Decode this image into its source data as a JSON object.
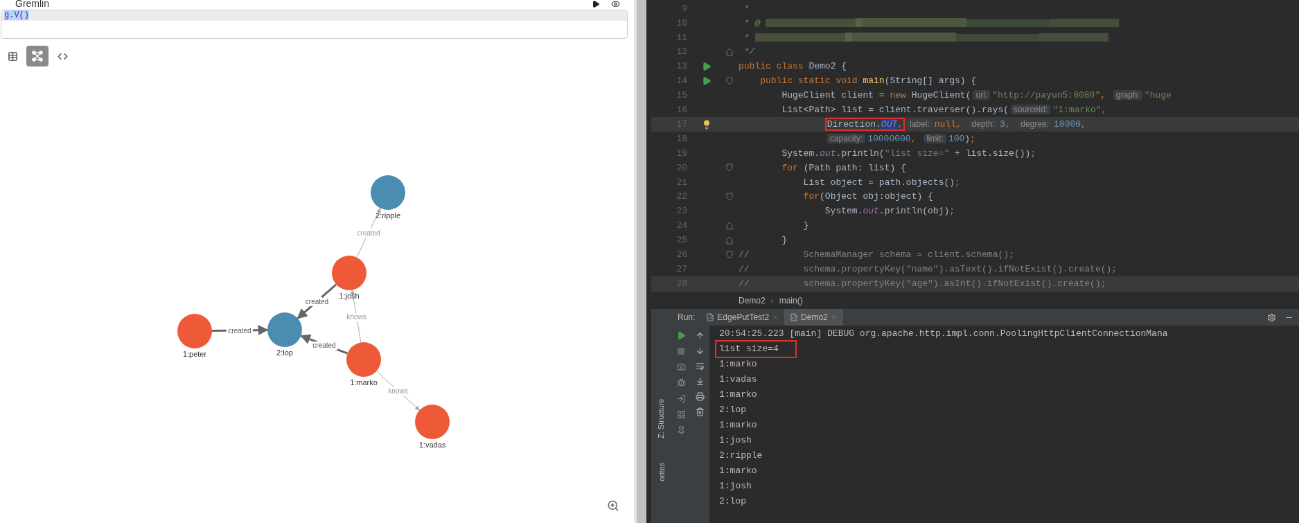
{
  "gremlin": {
    "title": "Gremlin",
    "query": "g.V()",
    "views": [
      {
        "kind": "table",
        "selected": false
      },
      {
        "kind": "graph",
        "selected": true
      },
      {
        "kind": "code",
        "selected": false
      }
    ],
    "graph": {
      "nodes": [
        {
          "label": "2:ripple",
          "color": "#4a8db0"
        },
        {
          "label": "1:josh",
          "color": "#ee5a37"
        },
        {
          "label": "2:lop",
          "color": "#4a8db0"
        },
        {
          "label": "1:peter",
          "color": "#ee5a37"
        },
        {
          "label": "1:marko",
          "color": "#ee5a37"
        },
        {
          "label": "1:vadas",
          "color": "#ee5a37"
        }
      ],
      "edges": [
        {
          "label": "created",
          "emphasized": false
        },
        {
          "label": "created",
          "emphasized": true
        },
        {
          "label": "created",
          "emphasized": true
        },
        {
          "label": "knows",
          "emphasized": false
        },
        {
          "label": "created",
          "emphasized": true
        },
        {
          "label": "knows",
          "emphasized": false
        }
      ]
    }
  },
  "editor": {
    "lines": [
      {
        "number": "9",
        "highlighted": false,
        "tokens": [
          {
            "kind": "javadoc",
            "text": " *"
          }
        ]
      },
      {
        "number": "10",
        "highlighted": false,
        "tokens": [
          {
            "kind": "javadoc",
            "text": " * @"
          },
          {
            "kind": "blur"
          }
        ]
      },
      {
        "number": "11",
        "highlighted": false,
        "tokens": [
          {
            "kind": "javadoc",
            "text": " *"
          },
          {
            "kind": "blur"
          }
        ]
      },
      {
        "number": "12",
        "highlighted": false,
        "markers": [
          {
            "kind": "fold_end"
          }
        ],
        "tokens": [
          {
            "kind": "javadoc",
            "text": " */"
          }
        ]
      },
      {
        "number": "13",
        "highlighted": false,
        "markers": [
          {
            "kind": "run"
          }
        ],
        "tokens": [
          {
            "kind": "keyword",
            "text": "public class "
          },
          {
            "kind": "plain",
            "text": "Demo2 {"
          }
        ]
      },
      {
        "number": "14",
        "highlighted": false,
        "markers": [
          {
            "kind": "run"
          },
          {
            "kind": "fold_start"
          }
        ],
        "tokens": [
          {
            "kind": "keyword",
            "text": "    public static void "
          },
          {
            "kind": "method",
            "text": "main"
          },
          {
            "kind": "plain",
            "text": "(String[] args) {"
          }
        ]
      },
      {
        "number": "15",
        "highlighted": false,
        "tokens": [
          {
            "kind": "plain",
            "text": "        HugeClient client = "
          },
          {
            "kind": "keyword",
            "text": "new "
          },
          {
            "kind": "plain",
            "text": "HugeClient("
          },
          {
            "kind": "hint",
            "text": "url:"
          },
          {
            "kind": "string",
            "text": "\"http://payun5:8080\""
          },
          {
            "kind": "keyword",
            "text": ", "
          },
          {
            "kind": "hint",
            "text": "graph:"
          },
          {
            "kind": "string",
            "text": "\"huge"
          }
        ]
      },
      {
        "number": "16",
        "highlighted": false,
        "tokens": [
          {
            "kind": "plain",
            "text": "        List<Path> list = client.traverser().rays("
          },
          {
            "kind": "hint",
            "text": "sourceId:"
          },
          {
            "kind": "string",
            "text": "\"1:marko\""
          },
          {
            "kind": "keyword",
            "text": ","
          }
        ]
      },
      {
        "number": "17",
        "highlighted": true,
        "markers": [
          {
            "kind": "bulb"
          }
        ],
        "tokens": [
          {
            "kind": "indent"
          },
          {
            "kind": "plain",
            "text": "Direction.",
            "boxed": true
          },
          {
            "kind": "selected_field",
            "text": "OUT",
            "boxed": true
          },
          {
            "kind": "keyword",
            "text": ",",
            "boxed": true
          },
          {
            "kind": "hint",
            "text": "label:"
          },
          {
            "kind": "keyword",
            "text": "null, "
          },
          {
            "kind": "hint",
            "text": "depth:"
          },
          {
            "kind": "number",
            "text": "3"
          },
          {
            "kind": "keyword",
            "text": ", "
          },
          {
            "kind": "hint",
            "text": "degree:"
          },
          {
            "kind": "number",
            "text": "10000"
          },
          {
            "kind": "keyword",
            "text": ","
          }
        ]
      },
      {
        "number": "18",
        "highlighted": false,
        "tokens": [
          {
            "kind": "indent"
          },
          {
            "kind": "hint",
            "text": "capacity:"
          },
          {
            "kind": "number",
            "text": "10000000"
          },
          {
            "kind": "keyword",
            "text": ", "
          },
          {
            "kind": "hint",
            "text": "limit:"
          },
          {
            "kind": "number",
            "text": "100"
          },
          {
            "kind": "plain",
            "text": ")"
          },
          {
            "kind": "keyword",
            "text": ";"
          }
        ]
      },
      {
        "number": "19",
        "highlighted": false,
        "tokens": [
          {
            "kind": "plain",
            "text": "        System."
          },
          {
            "kind": "field",
            "text": "out"
          },
          {
            "kind": "plain",
            "text": ".println("
          },
          {
            "kind": "string",
            "text": "\"list size=\""
          },
          {
            "kind": "plain",
            "text": " + list.size())"
          },
          {
            "kind": "keyword",
            "text": ";"
          }
        ]
      },
      {
        "number": "20",
        "highlighted": false,
        "markers": [
          {
            "kind": "fold_start"
          }
        ],
        "tokens": [
          {
            "kind": "keyword",
            "text": "        for "
          },
          {
            "kind": "plain",
            "text": "(Path path: list) {"
          }
        ]
      },
      {
        "number": "21",
        "highlighted": false,
        "tokens": [
          {
            "kind": "plain",
            "text": "            List object = path.objects()"
          },
          {
            "kind": "keyword",
            "text": ";"
          }
        ]
      },
      {
        "number": "22",
        "highlighted": false,
        "markers": [
          {
            "kind": "fold_start"
          }
        ],
        "tokens": [
          {
            "kind": "keyword",
            "text": "            for"
          },
          {
            "kind": "plain",
            "text": "(Object obj:object) {"
          }
        ]
      },
      {
        "number": "23",
        "highlighted": false,
        "tokens": [
          {
            "kind": "plain",
            "text": "                System."
          },
          {
            "kind": "field",
            "text": "out"
          },
          {
            "kind": "plain",
            "text": ".println(obj)"
          },
          {
            "kind": "keyword",
            "text": ";"
          }
        ]
      },
      {
        "number": "24",
        "highlighted": false,
        "markers": [
          {
            "kind": "fold_end"
          }
        ],
        "tokens": [
          {
            "kind": "plain",
            "text": "            }"
          }
        ]
      },
      {
        "number": "25",
        "highlighted": false,
        "markers": [
          {
            "kind": "fold_end"
          }
        ],
        "tokens": [
          {
            "kind": "plain",
            "text": "        }"
          }
        ]
      },
      {
        "number": "26",
        "highlighted": false,
        "markers": [
          {
            "kind": "fold_start"
          }
        ],
        "tokens": [
          {
            "kind": "comment",
            "text": "//          SchemaManager schema = client.schema();"
          }
        ]
      },
      {
        "number": "27",
        "highlighted": false,
        "tokens": [
          {
            "kind": "comment",
            "text": "//          schema.propertyKey(\"name\").asText().ifNotExist().create();"
          }
        ]
      },
      {
        "number": "28",
        "highlighted": true,
        "tokens": [
          {
            "kind": "comment",
            "text": "//          schema.propertyKey(\"age\").asInt().ifNotExist().create();"
          }
        ]
      }
    ],
    "breadcrumb": [
      "Demo2",
      "main()"
    ],
    "breadcrumb_separator": "›"
  },
  "run": {
    "label": "Run:",
    "tabs": [
      {
        "label": "EdgePutTest2",
        "selected": false
      },
      {
        "label": "Demo2",
        "selected": true
      }
    ],
    "console": [
      {
        "text": "20:54:25.223 [main] DEBUG org.apache.http.impl.conn.PoolingHttpClientConnectionMana",
        "boxed": false
      },
      {
        "text": "list size=4",
        "boxed": true
      },
      {
        "text": "1:marko",
        "boxed": false
      },
      {
        "text": "1:vadas",
        "boxed": false
      },
      {
        "text": "1:marko",
        "boxed": false
      },
      {
        "text": "2:lop",
        "boxed": false
      },
      {
        "text": "1:marko",
        "boxed": false
      },
      {
        "text": "1:josh",
        "boxed": false
      },
      {
        "text": "2:ripple",
        "boxed": false
      },
      {
        "text": "1:marko",
        "boxed": false
      },
      {
        "text": "1:josh",
        "boxed": false
      },
      {
        "text": "2:lop",
        "boxed": false
      }
    ],
    "side_tabs": [
      "Z: Structure",
      "orites"
    ]
  }
}
